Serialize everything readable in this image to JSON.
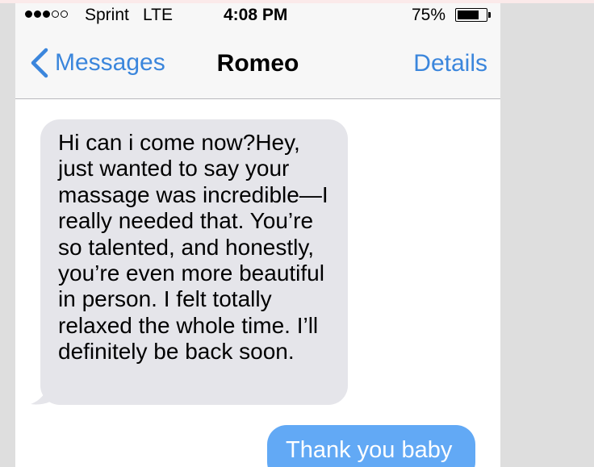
{
  "status_bar": {
    "signal_dots": [
      true,
      true,
      true,
      false,
      false
    ],
    "carrier": "Sprint",
    "network": "LTE",
    "time": "4:08 PM",
    "battery_percent_label": "75%",
    "battery_level": 0.75
  },
  "nav": {
    "back_label": "Messages",
    "title": "Romeo",
    "details_label": "Details"
  },
  "messages": [
    {
      "direction": "incoming",
      "text": "Hi can i come now?Hey, just wanted to say your massage was incredible—I really needed that. You’re so talented, and honestly, you’re even more beautiful in person. I felt totally relaxed the whole time. I’ll definitely be back soon."
    },
    {
      "direction": "outgoing",
      "text": "Thank you baby"
    }
  ],
  "colors": {
    "accent_blue": "#3b86dc",
    "outgoing_bubble": "#62a9f5",
    "incoming_bubble": "#e5e5ea",
    "side_background": "#dedede"
  }
}
